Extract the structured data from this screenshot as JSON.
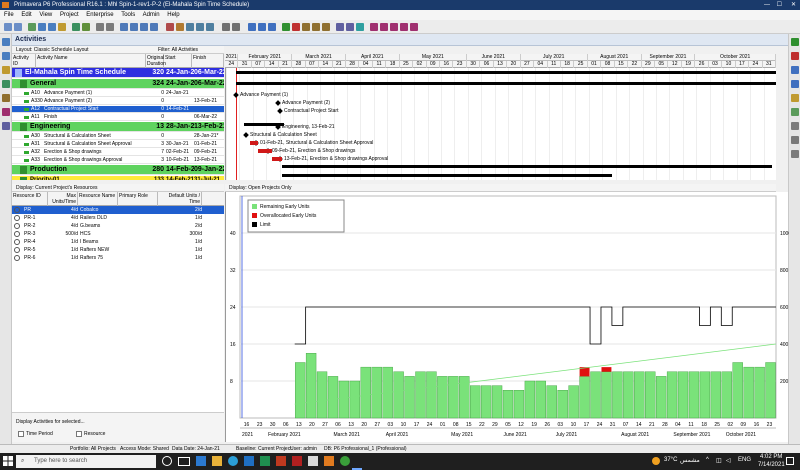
{
  "window": {
    "title": "Primavera P6 Professional R16.1 : Mhl Spin-1-rev1-P-2 (El-Mahala Spin Time Schedule)"
  },
  "menu": [
    "File",
    "Edit",
    "View",
    "Project",
    "Enterprise",
    "Tools",
    "Admin",
    "Help"
  ],
  "panel_title": "Activities",
  "layout_label": "Layout: Classic Schedule Layout",
  "filter_label": "Filter: All Activities",
  "activity_columns": [
    "Activity ID",
    "Activity Name",
    "Original Duration",
    "Start",
    "Finish"
  ],
  "activities": [
    {
      "id": "",
      "name": "El-Mahala Spin Time Schedule",
      "dur": "320",
      "start": "24-Jan-21",
      "finish": "06-Mar-22",
      "kind": "project"
    },
    {
      "id": "",
      "name": "General",
      "dur": "324",
      "start": "24-Jan-21",
      "finish": "06-Mar-22",
      "kind": "wbs"
    },
    {
      "id": "A10",
      "name": "Advance Payment (1)",
      "dur": "0",
      "start": "24-Jan-21",
      "finish": "",
      "kind": "task"
    },
    {
      "id": "A330",
      "name": "Advance Payment (2)",
      "dur": "0",
      "start": "",
      "finish": "13-Feb-21",
      "kind": "task"
    },
    {
      "id": "A12",
      "name": "Contractual Project Start",
      "dur": "0",
      "start": "14-Feb-21",
      "finish": "",
      "kind": "selected"
    },
    {
      "id": "A11",
      "name": "Finish",
      "dur": "0",
      "start": "",
      "finish": "06-Mar-22",
      "kind": "task"
    },
    {
      "id": "",
      "name": "Engineering",
      "dur": "13",
      "start": "28-Jan-21",
      "finish": "13-Feb-21",
      "kind": "wbs"
    },
    {
      "id": "A30",
      "name": "Structural & Calculation Sheet",
      "dur": "0",
      "start": "",
      "finish": "28-Jan-21*",
      "kind": "task"
    },
    {
      "id": "A31",
      "name": "Structural & Calculation Sheet Approval",
      "dur": "3",
      "start": "30-Jan-21",
      "finish": "01-Feb-21",
      "kind": "task"
    },
    {
      "id": "A32",
      "name": "Erection & Shop drawings",
      "dur": "7",
      "start": "02-Feb-21",
      "finish": "09-Feb-21",
      "kind": "task"
    },
    {
      "id": "A33",
      "name": "Erection & Shop drawings Approval",
      "dur": "3",
      "start": "10-Feb-21",
      "finish": "13-Feb-21",
      "kind": "task"
    },
    {
      "id": "",
      "name": "Production",
      "dur": "280",
      "start": "14-Feb-21",
      "finish": "09-Jan-22",
      "kind": "wbs"
    },
    {
      "id": "",
      "name": "Priority-01",
      "dur": "133",
      "start": "14-Feb-21",
      "finish": "31-Jul-21",
      "kind": "sub"
    }
  ],
  "gantt_years": [
    "2021",
    "2021"
  ],
  "gantt_months": [
    "February 2021",
    "March 2021",
    "April 2021",
    "May 2021",
    "June 2021",
    "July 2021",
    "August 2021",
    "September 2021",
    "October 2021"
  ],
  "gantt_weeks": [
    "24",
    "31",
    "07",
    "14",
    "21",
    "28",
    "07",
    "14",
    "21",
    "28",
    "04",
    "11",
    "18",
    "25",
    "02",
    "09",
    "16",
    "23",
    "30",
    "06",
    "13",
    "20",
    "27",
    "04",
    "11",
    "18",
    "25",
    "01",
    "08",
    "15",
    "22",
    "29",
    "05",
    "12",
    "19",
    "26",
    "03",
    "10",
    "17",
    "24",
    "31"
  ],
  "gantt_labels": [
    "Advance Payment (1)",
    "Advance Payment (2)",
    "Contractual Project Start",
    "Engineering, 13-Feb-21",
    "Structural & Calculation Sheet",
    "01-Feb-21, Structural & Calculation Sheet Approval",
    "09-Feb-21, Erection & Shop drawings",
    "13-Feb-21, Erection & Shop drawings Approval"
  ],
  "resources_caption": "Display: Current Project's Resources",
  "resource_columns": [
    "Resource ID",
    "Max Units/Time",
    "Resource Name",
    "Primary Role",
    "Default Units / Time"
  ],
  "resources": [
    {
      "id": "PR",
      "max": "4/d",
      "name": "Cobalco",
      "role": "",
      "units": "2/d",
      "selected": true
    },
    {
      "id": "PR-1",
      "max": "4/d",
      "name": "Railers DLD",
      "role": "",
      "units": "1/d"
    },
    {
      "id": "PR-2",
      "max": "4/d",
      "name": "G.beams",
      "role": "",
      "units": "2/d"
    },
    {
      "id": "PR-3",
      "max": "500/d",
      "name": "HCS",
      "role": "",
      "units": "300/d"
    },
    {
      "id": "PR-4",
      "max": "1/d",
      "name": "I Beams",
      "role": "",
      "units": "1/d"
    },
    {
      "id": "PR-5",
      "max": "1/d",
      "name": "Rafters NEW",
      "role": "",
      "units": "1/d"
    },
    {
      "id": "PR-6",
      "max": "1/d",
      "name": "Rafters 75",
      "role": "",
      "units": "1/d"
    }
  ],
  "resource_footer": "Display Activities for selected...",
  "time_period_label": "Time Period",
  "resource_check_label": "Resource",
  "profile_caption": "Display: Open Projects Only",
  "legend": [
    {
      "label": "Remaining Early Units",
      "color": "#7ae27a"
    },
    {
      "label": "Overallocated Early Units",
      "color": "#e01010"
    },
    {
      "label": "Limit",
      "color": "#000000"
    }
  ],
  "chart_data": {
    "type": "bar",
    "left_axis_ticks": [
      "40",
      "32",
      "24",
      "16",
      "8"
    ],
    "right_axis_ticks": [
      "1000",
      "800",
      "600",
      "400",
      "200"
    ],
    "x_weeks": [
      "16",
      "23",
      "30",
      "06",
      "13",
      "20",
      "27",
      "06",
      "13",
      "20",
      "27",
      "03",
      "10",
      "17",
      "24",
      "01",
      "08",
      "15",
      "22",
      "29",
      "05",
      "12",
      "19",
      "26",
      "03",
      "10",
      "17",
      "24",
      "31",
      "07",
      "14",
      "21",
      "28",
      "04",
      "11",
      "18",
      "25",
      "02",
      "09",
      "16",
      "23"
    ],
    "x_months": [
      "2021",
      "February 2021",
      "March 2021",
      "April 2021",
      "May 2021",
      "June 2021",
      "July 2021",
      "August 2021",
      "September 2021",
      "October 2021"
    ],
    "remaining_units": [
      0,
      0,
      0,
      0,
      0,
      12,
      14,
      10,
      9,
      8,
      8,
      11,
      11,
      11,
      10,
      9,
      10,
      10,
      9,
      9,
      9,
      7,
      7,
      7,
      6,
      6,
      8,
      8,
      7,
      6,
      7,
      9,
      10,
      10,
      10,
      10,
      10,
      10,
      9,
      10,
      10,
      10,
      10,
      10,
      10,
      12,
      11,
      11,
      12
    ],
    "overallocated_units": [
      0,
      0,
      0,
      0,
      0,
      0,
      0,
      0,
      0,
      0,
      0,
      0,
      0,
      0,
      0,
      0,
      0,
      0,
      0,
      0,
      0,
      0,
      0,
      0,
      0,
      0,
      0,
      0,
      0,
      0,
      0,
      2,
      0,
      1,
      0,
      0,
      0,
      0,
      0,
      0,
      0,
      0,
      0,
      0,
      0,
      0,
      0,
      0,
      0
    ],
    "limit": [
      0,
      0,
      0,
      0,
      0,
      16,
      24,
      24,
      24,
      24,
      24,
      24,
      24,
      24,
      24,
      24,
      24,
      24,
      24,
      24,
      24,
      24,
      24,
      24,
      24,
      24,
      24,
      24,
      24,
      24,
      24,
      24,
      16,
      24,
      20,
      24,
      24,
      24,
      24,
      24,
      24,
      24,
      20,
      24,
      20,
      24,
      24,
      24,
      24
    ]
  },
  "status": {
    "portfolio": "Portfolio: All Projects",
    "access": "Access Mode: Shared",
    "data_date": "Data Date: 24-Jan-21",
    "baseline": "Baseline: Current Project",
    "user": "User: admin",
    "db": "DB: P6 Professional_1 (Professional)"
  },
  "taskbar": {
    "search_placeholder": "Type here to search",
    "weather": "37°C",
    "weather_text": "مشمس",
    "lang": "ENG",
    "time": "4:02 PM",
    "date": "7/14/2021"
  }
}
